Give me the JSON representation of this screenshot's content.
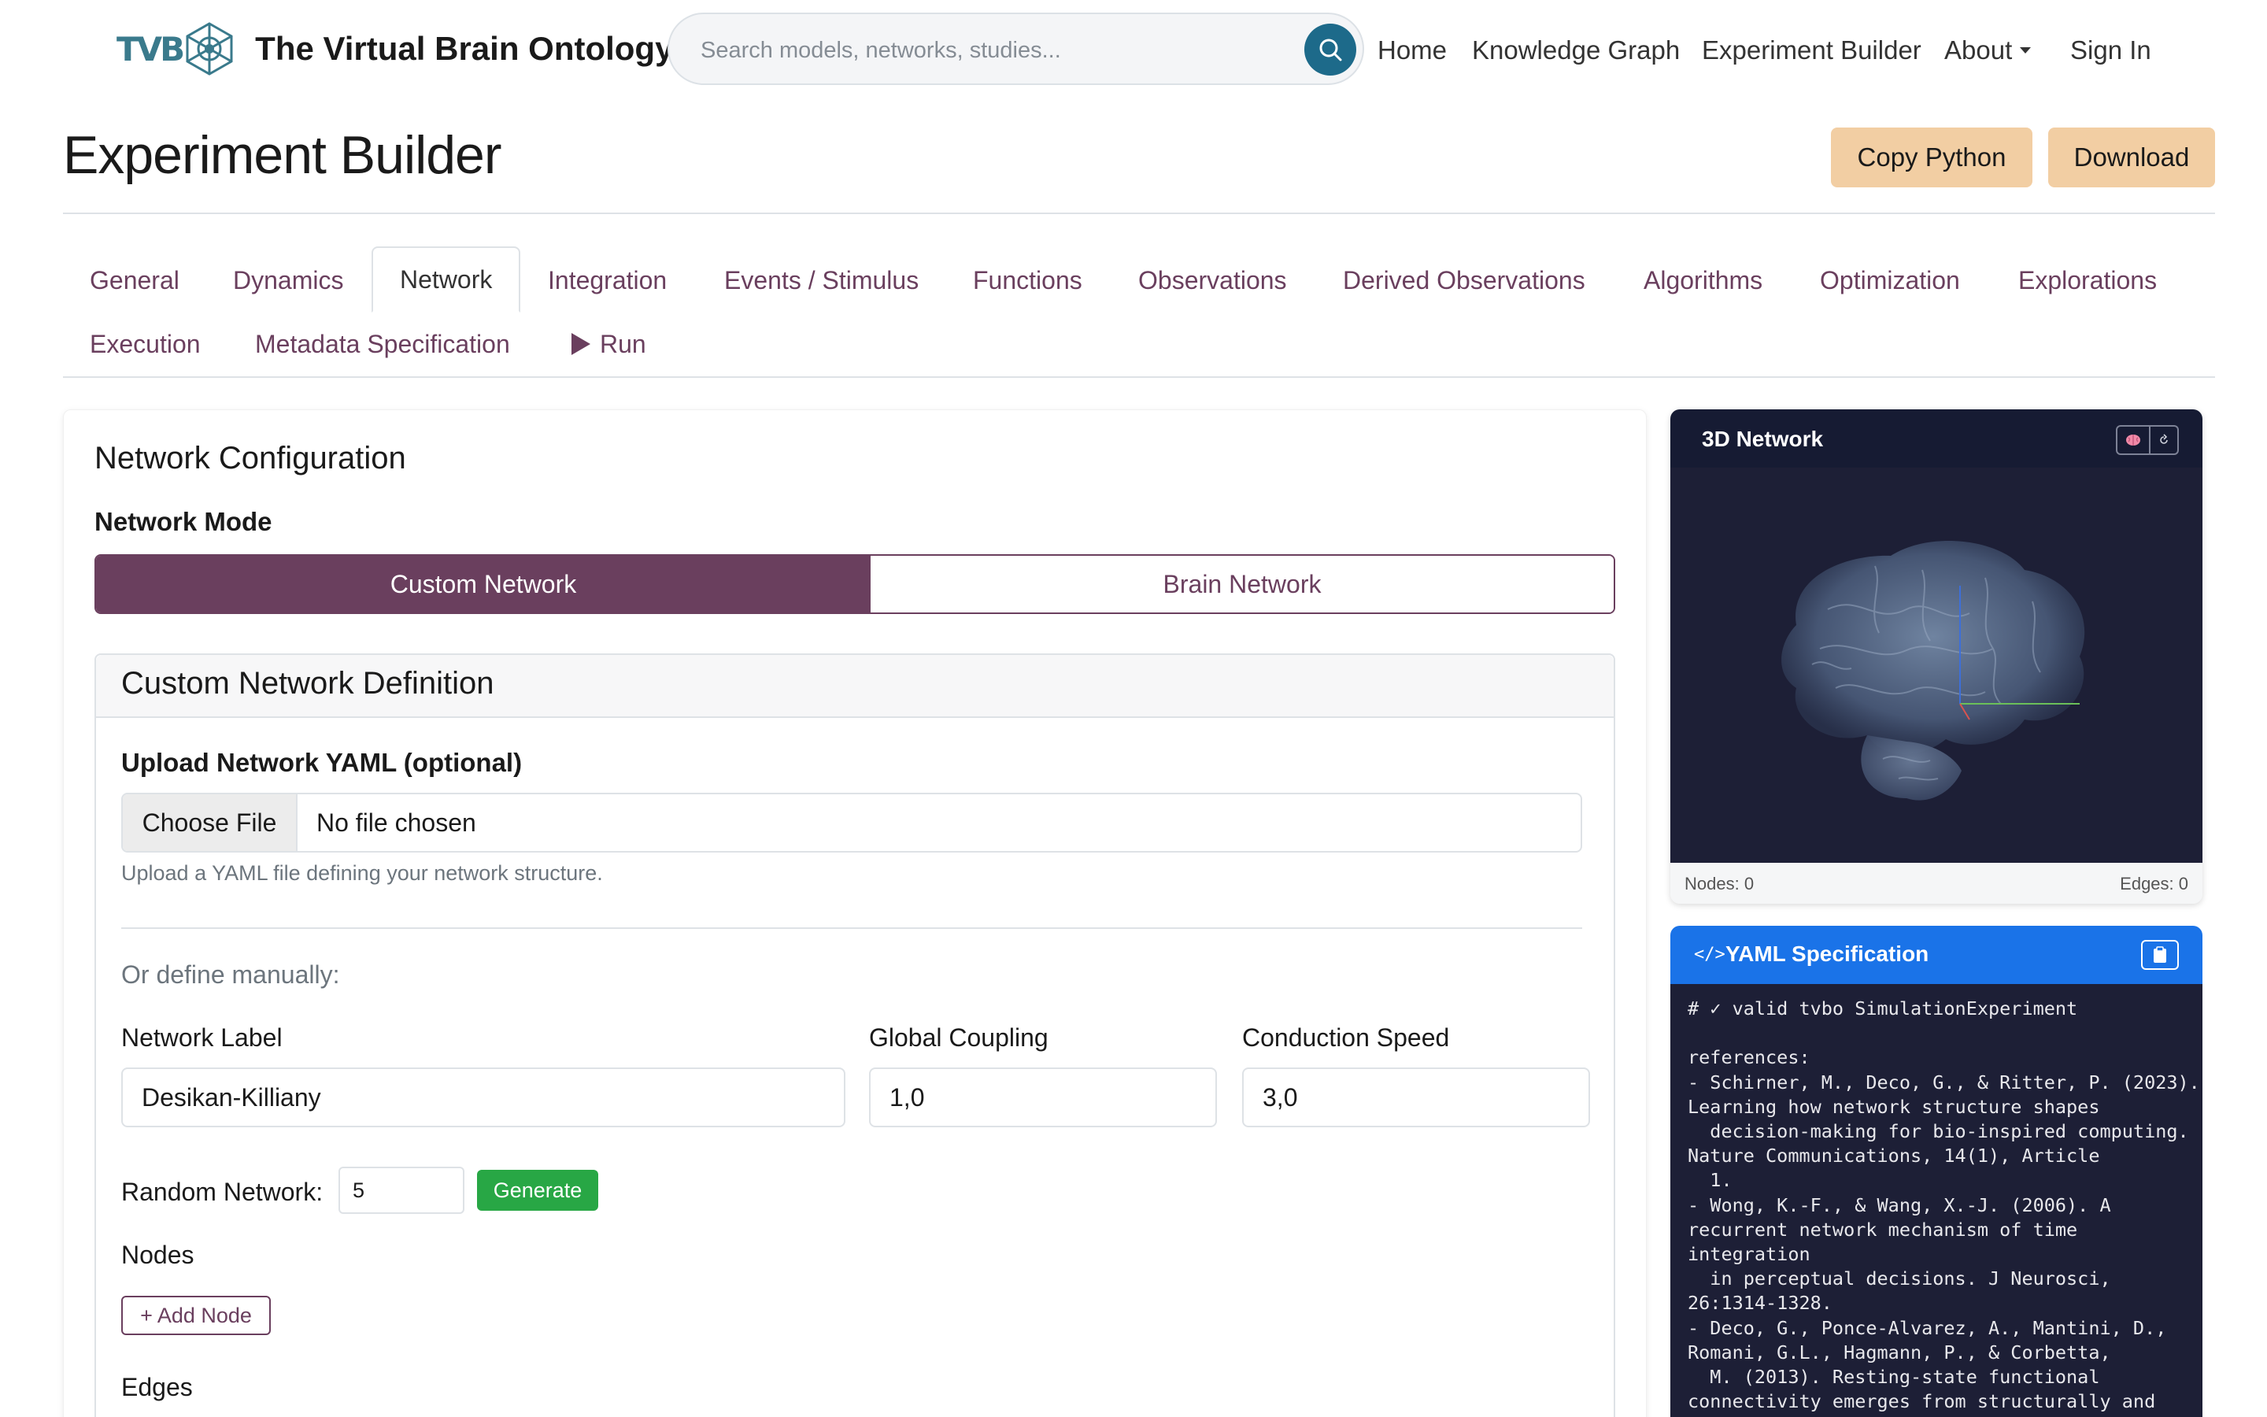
{
  "navbar": {
    "logo_text": "TVB",
    "brand_title": "The Virtual Brain Ontology",
    "search_placeholder": "Search models, networks, studies...",
    "links": {
      "home": "Home",
      "knowledge_graph": "Knowledge Graph",
      "experiment_builder": "Experiment Builder",
      "about": "About",
      "sign_in": "Sign In"
    }
  },
  "header": {
    "title": "Experiment Builder",
    "copy_python": "Copy Python",
    "download": "Download"
  },
  "tabs": {
    "general": "General",
    "dynamics": "Dynamics",
    "network": "Network",
    "integration": "Integration",
    "events": "Events / Stimulus",
    "functions": "Functions",
    "observations": "Observations",
    "derived_observations": "Derived Observations",
    "algorithms": "Algorithms",
    "optimization": "Optimization",
    "explorations": "Explorations",
    "execution": "Execution",
    "metadata": "Metadata Specification",
    "run": "Run",
    "active": "network"
  },
  "network_config": {
    "title": "Network Configuration",
    "mode_label": "Network Mode",
    "mode_custom": "Custom Network",
    "mode_brain": "Brain Network",
    "definition_title": "Custom Network Definition",
    "upload_label": "Upload Network YAML (optional)",
    "choose_file": "Choose File",
    "no_file": "No file chosen",
    "upload_help": "Upload a YAML file defining your network structure.",
    "or_define": "Or define manually:",
    "network_label_label": "Network Label",
    "network_label_value": "Desikan-Killiany",
    "global_coupling_label": "Global Coupling",
    "global_coupling_value": "1,0",
    "conduction_speed_label": "Conduction Speed",
    "conduction_speed_value": "3,0",
    "random_network_label": "Random Network:",
    "random_network_value": "5",
    "generate": "Generate",
    "nodes_label": "Nodes",
    "add_node": "+ Add Node",
    "edges_label": "Edges"
  },
  "network_3d": {
    "title": "3D Network",
    "nodes": "Nodes: 0",
    "edges": "Edges: 0"
  },
  "yaml_spec": {
    "title": "YAML Specification",
    "code": "# ✓ valid tvbo SimulationExperiment\n\nreferences:\n- Schirner, M., Deco, G., & Ritter, P. (2023).\nLearning how network structure shapes\n  decision-making for bio-inspired computing.\nNature Communications, 14(1), Article\n  1.\n- Wong, K.-F., & Wang, X.-J. (2006). A\nrecurrent network mechanism of time\nintegration\n  in perceptual decisions. J Neurosci,\n26:1314-1328.\n- Deco, G., Ponce-Alvarez, A., Mantini, D.,\nRomani, G.L., Hagmann, P., & Corbetta,\n  M. (2013). Resting-state functional\nconnectivity emerges from structurally and"
  },
  "colors": {
    "accent": "#6a3f5e",
    "peach_button": "#f2cea3",
    "generate_green": "#28a745",
    "yaml_header_blue": "#1a73e8",
    "dark_panel": "#1d1f36"
  }
}
